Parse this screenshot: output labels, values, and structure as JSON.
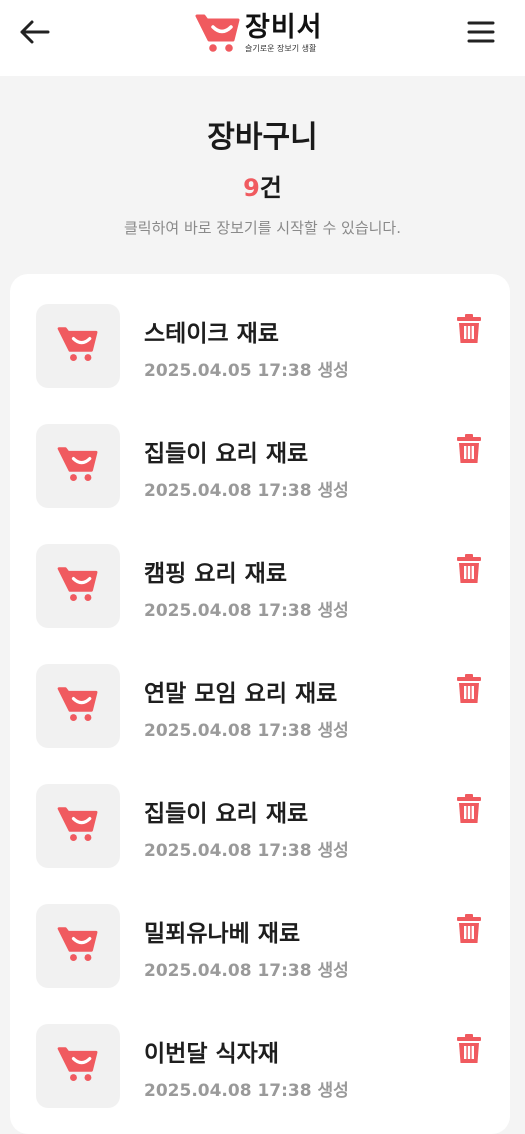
{
  "header": {
    "back_icon": "arrow-left-icon",
    "menu_icon": "hamburger-menu-icon",
    "logo_icon": "shopping-cart-icon",
    "logo_name": "장비서",
    "logo_tagline": "슬기로운 장보기 생활"
  },
  "hero": {
    "title": "장바구니",
    "count_number": "9",
    "count_unit": "건",
    "description": "클릭하여 바로 장보기를 시작할 수 있습니다."
  },
  "colors": {
    "accent": "#f05a5f",
    "background": "#f4f4f4",
    "card": "#ffffff",
    "thumb_bg": "#f1f1f1",
    "muted_text": "#9a9a9a"
  },
  "list": {
    "item_icon": "shopping-cart-icon",
    "delete_icon": "trash-icon",
    "items": [
      {
        "title": "스테이크 재료",
        "date": "2025.04.05 17:38 생성"
      },
      {
        "title": "집들이 요리 재료",
        "date": "2025.04.08 17:38 생성"
      },
      {
        "title": "캠핑 요리 재료",
        "date": "2025.04.08 17:38 생성"
      },
      {
        "title": "연말 모임 요리 재료",
        "date": "2025.04.08 17:38 생성"
      },
      {
        "title": "집들이 요리 재료",
        "date": "2025.04.08 17:38 생성"
      },
      {
        "title": "밀푀유나베 재료",
        "date": "2025.04.08 17:38 생성"
      },
      {
        "title": "이번달 식자재",
        "date": "2025.04.08 17:38 생성"
      }
    ]
  }
}
